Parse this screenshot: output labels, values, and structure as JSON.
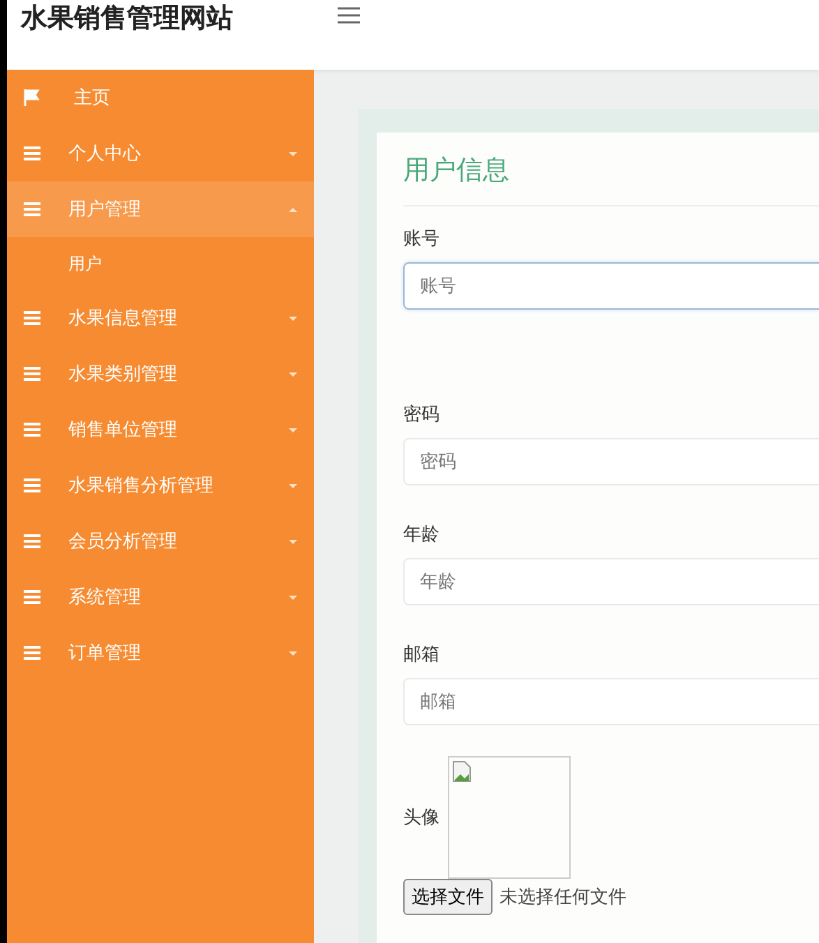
{
  "header": {
    "title": "水果销售管理网站"
  },
  "sidebar": {
    "items": [
      {
        "label": "主页",
        "kind": "home",
        "selected": false
      },
      {
        "label": "个人中心",
        "kind": "group",
        "selected": false,
        "expanded": false
      },
      {
        "label": "用户管理",
        "kind": "group",
        "selected": true,
        "expanded": true,
        "children": [
          {
            "label": "用户",
            "selected": false
          }
        ]
      },
      {
        "label": "水果信息管理",
        "kind": "group",
        "selected": false,
        "expanded": false
      },
      {
        "label": "水果类别管理",
        "kind": "group",
        "selected": false,
        "expanded": false
      },
      {
        "label": "销售单位管理",
        "kind": "group",
        "selected": false,
        "expanded": false
      },
      {
        "label": "水果销售分析管理",
        "kind": "group",
        "selected": false,
        "expanded": false
      },
      {
        "label": "会员分析管理",
        "kind": "group",
        "selected": false,
        "expanded": false
      },
      {
        "label": "系统管理",
        "kind": "group",
        "selected": false,
        "expanded": false
      },
      {
        "label": "订单管理",
        "kind": "group",
        "selected": false,
        "expanded": false
      }
    ]
  },
  "form": {
    "title": "用户信息",
    "fields": [
      {
        "kind": "text",
        "label": "账号",
        "placeholder": "账号",
        "focused": true
      },
      {
        "kind": "text",
        "label": "密码",
        "placeholder": "密码",
        "focused": false
      },
      {
        "kind": "text",
        "label": "年龄",
        "placeholder": "年龄",
        "focused": false
      },
      {
        "kind": "text",
        "label": "邮箱",
        "placeholder": "邮箱",
        "focused": false
      },
      {
        "kind": "image",
        "label": "头像",
        "button": "选择文件",
        "status": "未选择任何文件"
      }
    ]
  }
}
